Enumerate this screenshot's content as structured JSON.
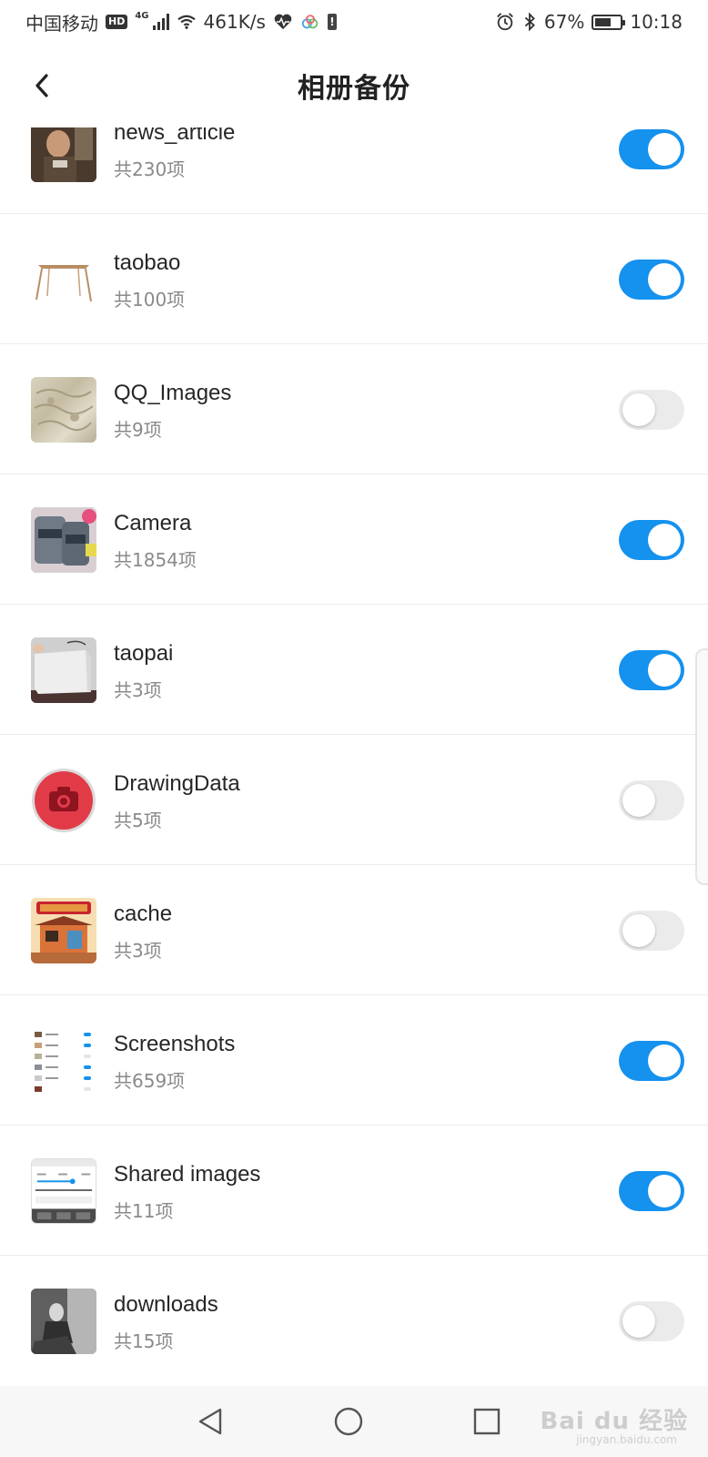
{
  "status_bar": {
    "carrier": "中国移动",
    "hd": "HD",
    "network": "4G",
    "speed": "461K/s",
    "battery": "67%",
    "battery_level": 0.67,
    "time": "10:18"
  },
  "header": {
    "title": "相册备份"
  },
  "albums": [
    {
      "name": "news_article",
      "count": "共230项",
      "enabled": true
    },
    {
      "name": "taobao",
      "count": "共100项",
      "enabled": true
    },
    {
      "name": "QQ_Images",
      "count": "共9项",
      "enabled": false
    },
    {
      "name": "Camera",
      "count": "共1854项",
      "enabled": true
    },
    {
      "name": "taopai",
      "count": "共3项",
      "enabled": true
    },
    {
      "name": "DrawingData",
      "count": "共5项",
      "enabled": false
    },
    {
      "name": "cache",
      "count": "共3项",
      "enabled": false
    },
    {
      "name": "Screenshots",
      "count": "共659项",
      "enabled": true
    },
    {
      "name": "Shared images",
      "count": "共11项",
      "enabled": true
    },
    {
      "name": "downloads",
      "count": "共15项",
      "enabled": false
    }
  ],
  "watermark": {
    "text": "Bai du 经验",
    "url": "jingyan.baidu.com"
  },
  "colors": {
    "accent": "#1591ee",
    "toggle_off": "#ebebeb"
  }
}
